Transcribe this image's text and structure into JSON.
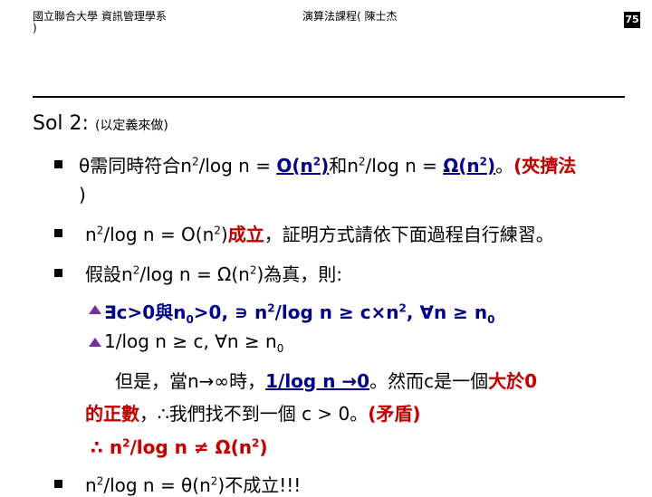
{
  "header": {
    "left_line1": "國立聯合大學 資訊管理學系",
    "left_line2": ")",
    "center": "演算法課程( 陳士杰",
    "page_number": "75"
  },
  "title": {
    "main": "Sol 2:",
    "note": "(以定義來做)"
  },
  "items": {
    "b1": {
      "theta": "θ",
      "text1": "需同時符合",
      "n2": "n",
      "exp": "2",
      "logn": "/log n = ",
      "big_o": "O(n",
      "big_o_end": ")",
      "and": "和",
      "n2b": "n",
      "logn2": "/log n = ",
      "omega": "Ω(n",
      "omega_end": ")",
      "period": "。",
      "squeeze": "(夾擠法",
      "close": ")"
    },
    "b2": {
      "n": "n",
      "exp": "2",
      "mid": "/log n = O(n",
      "exp2": "2",
      "close": ")",
      "holds": "成立",
      "rest": "，証明方式請依下面過程自行練習。"
    },
    "b3": {
      "text": "假設",
      "n": "n",
      "exp": "2",
      "mid": "/log n = Ω(n",
      "exp2": "2",
      "rest": ")為真，則:"
    },
    "s1": {
      "text": "∃c>0與n",
      "sub0": "0",
      "mid": ">0, ∍ n",
      "exp": "2",
      "mid2": "/log n ≥ c×n",
      "exp2": "2",
      "mid3": ", ∀n ≥ n",
      "sub1": "0"
    },
    "s2": {
      "text": "1/log n ≥ c, ∀n ≥ n",
      "sub": "0"
    },
    "p1": {
      "text1": "但是，當n→∞時，",
      "limit": "1/log n →0",
      "text2": "。然而c是一個",
      "positive": "大於0"
    },
    "p2": {
      "positive2": "的正數",
      "text": "，∴我們找不到一個 c > 0。",
      "contra": "(矛盾)"
    },
    "conclusion": {
      "therefore": "∴",
      "text": "n",
      "exp": "2",
      "rest": "/log n ≠ Ω(n",
      "exp2": "2",
      "close": ")"
    },
    "b4": {
      "text": "n",
      "exp": "2",
      "rest": "/log n = θ(n",
      "exp2": "2",
      "close": ")不成立!!!"
    }
  },
  "colors": {
    "accent_red": "#c00000",
    "accent_blue": "#00008b",
    "sub_bullet": "#7030a0"
  }
}
